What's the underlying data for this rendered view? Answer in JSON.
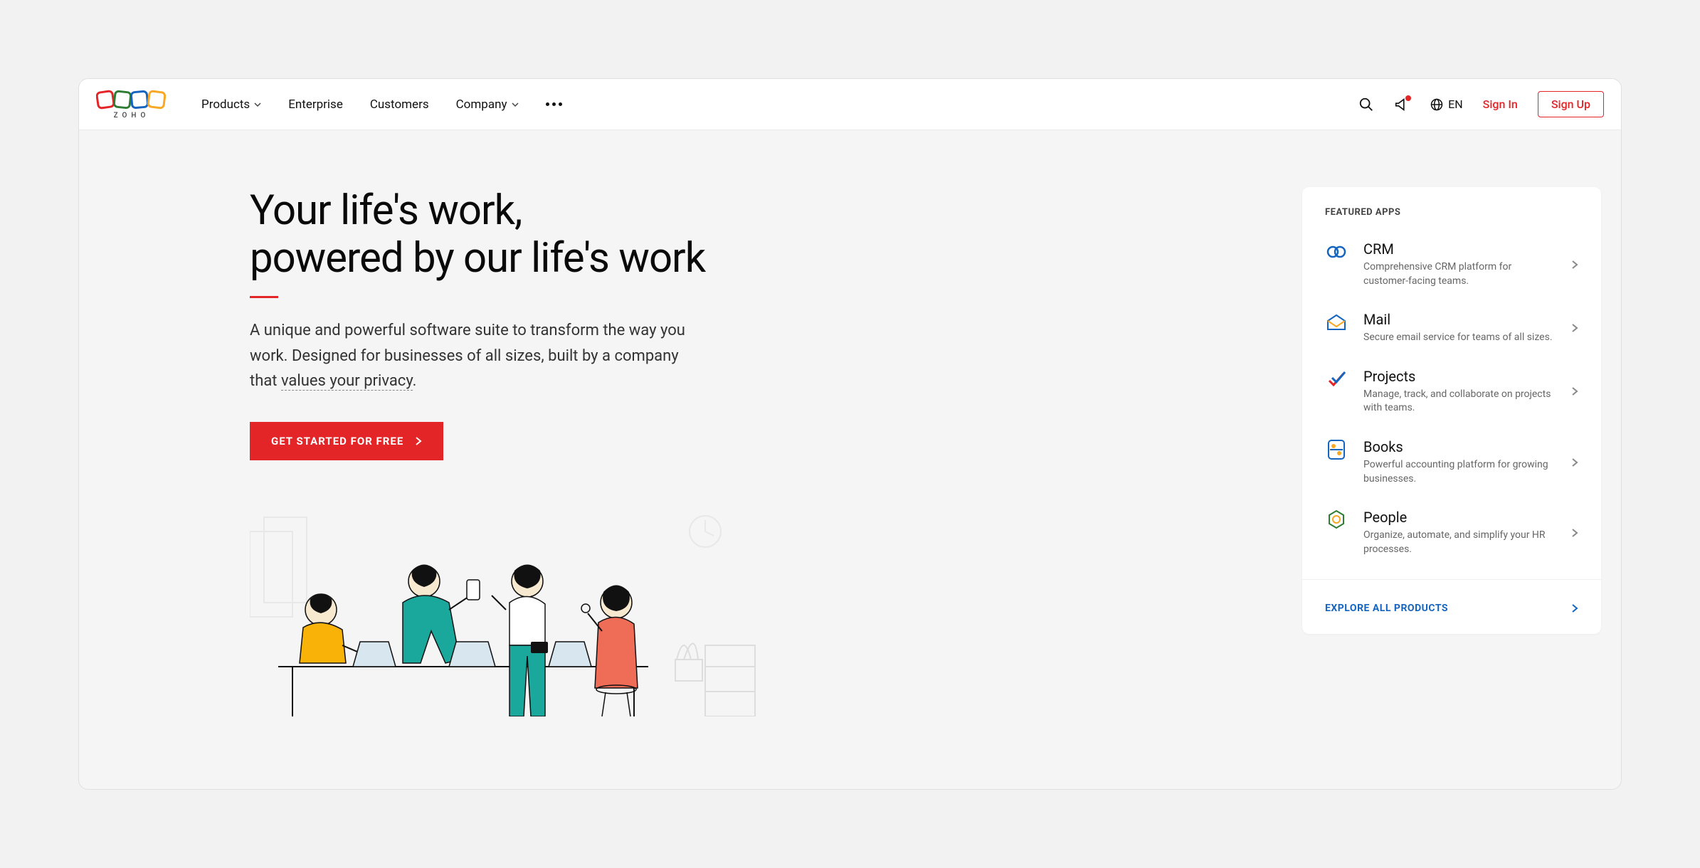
{
  "logo": {
    "text": "ZOHO"
  },
  "nav": {
    "products": "Products",
    "enterprise": "Enterprise",
    "customers": "Customers",
    "company": "Company"
  },
  "topbar": {
    "lang": "EN",
    "signin": "Sign In",
    "signup": "Sign Up"
  },
  "hero": {
    "title_line1": "Your life's work,",
    "title_line2": "powered by our life's work",
    "desc_pre": "A unique and powerful software suite to transform the way you work. Designed for businesses of all sizes, built by a company that ",
    "desc_link": "values your privacy",
    "desc_post": ".",
    "cta": "GET STARTED FOR FREE"
  },
  "sidebar": {
    "heading": "FEATURED APPS",
    "apps": [
      {
        "title": "CRM",
        "desc": "Comprehensive CRM platform for customer-facing teams."
      },
      {
        "title": "Mail",
        "desc": "Secure email service for teams of all sizes."
      },
      {
        "title": "Projects",
        "desc": "Manage, track, and collaborate on projects with teams."
      },
      {
        "title": "Books",
        "desc": "Powerful accounting platform for growing businesses."
      },
      {
        "title": "People",
        "desc": "Organize, automate, and simplify your HR processes."
      }
    ],
    "explore": "EXPLORE ALL PRODUCTS"
  }
}
